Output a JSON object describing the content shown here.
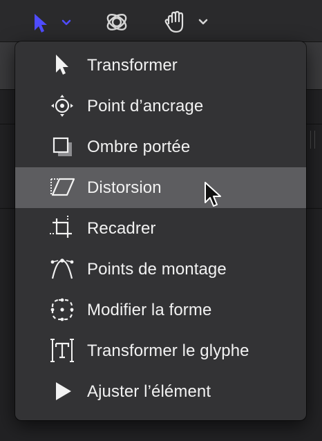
{
  "toolbar": {
    "tools": [
      {
        "icon": "arrow-select-icon",
        "active": true
      },
      {
        "icon": "3d-orbit-icon",
        "active": false
      },
      {
        "icon": "hand-pan-icon",
        "active": false
      }
    ],
    "accent_color": "#4f4cff"
  },
  "menu": {
    "items": [
      {
        "label": "Transformer",
        "icon": "arrow-pointer-icon"
      },
      {
        "label": "Point d’ancrage",
        "icon": "anchor-point-icon"
      },
      {
        "label": "Ombre portée",
        "icon": "drop-shadow-icon"
      },
      {
        "label": "Distorsion",
        "icon": "distort-icon",
        "selected": true
      },
      {
        "label": "Recadrer",
        "icon": "crop-icon"
      },
      {
        "label": "Points de montage",
        "icon": "edit-points-icon"
      },
      {
        "label": "Modifier la forme",
        "icon": "adjust-shape-icon"
      },
      {
        "label": "Transformer le glyphe",
        "icon": "transform-glyph-icon"
      },
      {
        "label": "Ajuster l’élément",
        "icon": "adjust-item-icon"
      }
    ]
  }
}
